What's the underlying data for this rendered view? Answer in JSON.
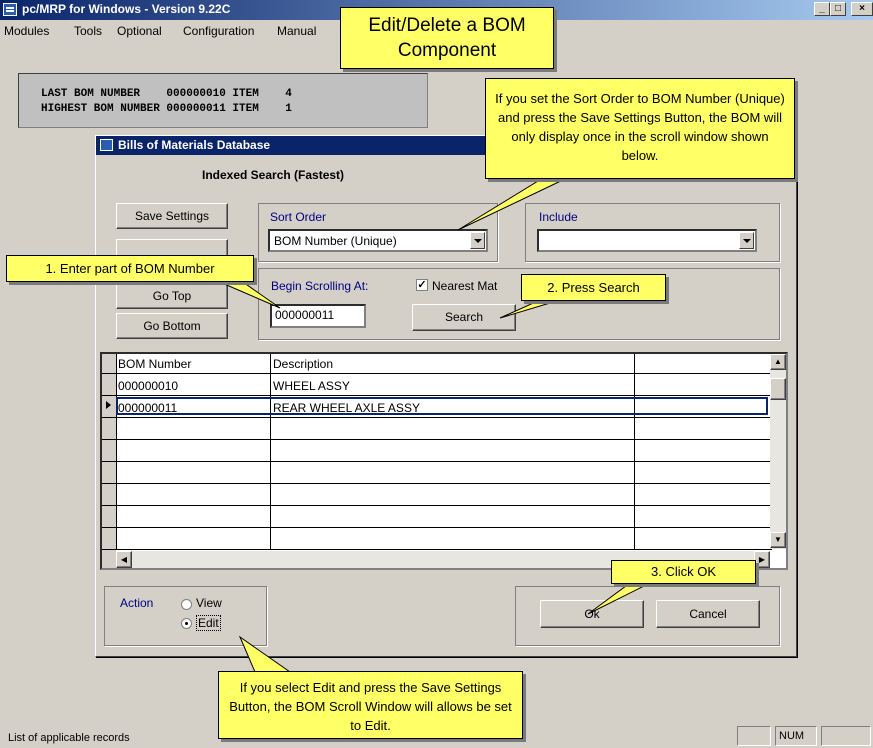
{
  "app": {
    "title": "pc/MRP for Windows - Version 9.22C",
    "window_controls": [
      "minimize-icon",
      "maximize-icon",
      "close-icon"
    ]
  },
  "menu": [
    "Modules",
    "Tools",
    "Optional",
    "Configuration",
    "Manual"
  ],
  "bom_header": {
    "line1": "LAST BOM NUMBER    000000010 ITEM    4",
    "line2": "HIGHEST BOM NUMBER 000000011 ITEM    1"
  },
  "dialog": {
    "title": "Bills of Materials Database",
    "search_mode": "Indexed Search (Fastest)",
    "buttons": {
      "save_settings": "Save Settings",
      "go_top": "Go Top",
      "go_bottom": "Go Bottom",
      "search": "Search",
      "ok": "Ok",
      "cancel": "Cancel"
    },
    "sort_order": {
      "label": "Sort Order",
      "value": "BOM Number (Unique)"
    },
    "include": {
      "label": "Include",
      "value": ""
    },
    "begin_scrolling": {
      "label": "Begin Scrolling At:",
      "value": "000000011"
    },
    "nearest_match": {
      "label": "Nearest Mat",
      "checked": true
    },
    "grid": {
      "columns": [
        "BOM Number",
        "Description",
        ""
      ],
      "rows": [
        {
          "bom": "000000010",
          "desc": "WHEEL ASSY"
        },
        {
          "bom": "000000011",
          "desc": "REAR WHEEL AXLE ASSY"
        }
      ],
      "selected_row": 1
    },
    "action": {
      "label": "Action",
      "options": [
        "View",
        "Edit"
      ],
      "selected": "Edit"
    }
  },
  "callouts": {
    "heading": "Edit/Delete a BOM Component",
    "sort_tip": "If you set the Sort Order to BOM Number (Unique) and press the Save Settings Button, the BOM will only display once in the scroll window shown below.",
    "step1": "1. Enter part of BOM Number",
    "step2": "2. Press Search",
    "step3": "3. Click OK",
    "edit_tip": "If you select Edit and press the Save Settings Button, the BOM Scroll Window will allows be set to Edit."
  },
  "status": {
    "text": "List of applicable records",
    "num": "NUM"
  },
  "colors": {
    "title_bar": "#0a246a",
    "callout": "#ffff66",
    "face": "#d4d0c8"
  }
}
